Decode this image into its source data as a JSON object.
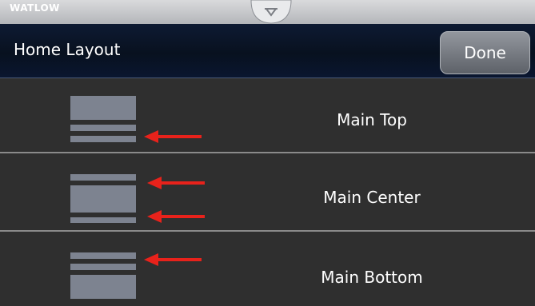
{
  "brand": "WATLOW",
  "header": {
    "title": "Home Layout",
    "done_label": "Done"
  },
  "rows": [
    {
      "label": "Main Top",
      "layout_icon": "layout-top-icon"
    },
    {
      "label": "Main Center",
      "layout_icon": "layout-center-icon"
    },
    {
      "label": "Main Bottom",
      "layout_icon": "layout-bottom-icon"
    }
  ],
  "icons": {
    "pull_tab": "pull-down-tab-icon",
    "arrow": "red-arrow-icon"
  },
  "colors": {
    "header_bg": "#08111f",
    "row_bg": "#2f2f2f",
    "accent_arrow": "#e8221b",
    "icon_block": "#7d8390"
  }
}
